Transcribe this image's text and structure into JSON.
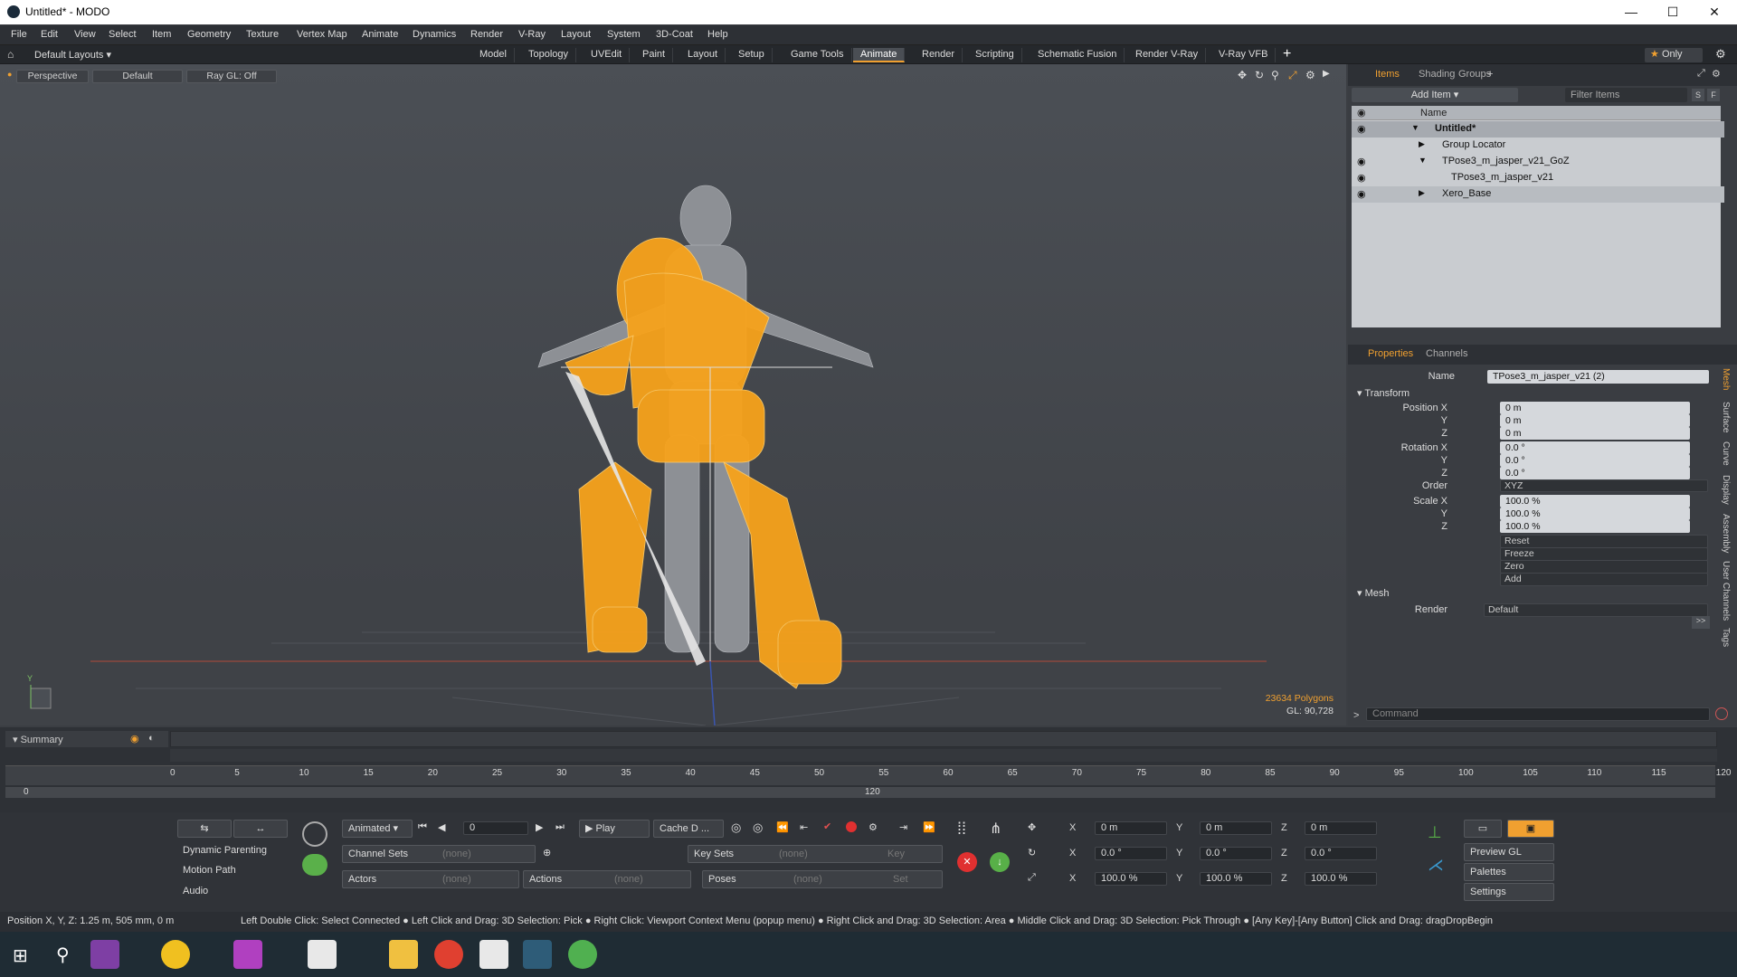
{
  "window": {
    "title": "Untitled* - MODO",
    "minimize": "—",
    "maximize": "☐",
    "close": "✕"
  },
  "menu": [
    "File",
    "Edit",
    "View",
    "Select",
    "Item",
    "Geometry",
    "Texture",
    "Vertex Map",
    "Animate",
    "Dynamics",
    "Render",
    "V-Ray",
    "Layout",
    "System",
    "3D-Coat",
    "Help"
  ],
  "layout_selector": "Default Layouts",
  "layout_tabs": [
    {
      "label": "Model",
      "active": false
    },
    {
      "label": "Topology",
      "active": false
    },
    {
      "label": "UVEdit",
      "active": false
    },
    {
      "label": "Paint",
      "active": false
    },
    {
      "label": "Layout",
      "active": false
    },
    {
      "label": "Setup",
      "active": false
    },
    {
      "label": "Game Tools",
      "active": false
    },
    {
      "label": "Animate",
      "active": true
    },
    {
      "label": "Render",
      "active": false
    },
    {
      "label": "Scripting",
      "active": false
    },
    {
      "label": "Schematic Fusion",
      "active": false
    },
    {
      "label": "Render V-Ray",
      "active": false
    },
    {
      "label": "V-Ray VFB",
      "active": false
    }
  ],
  "add_tab": "+",
  "only_label": "Only",
  "viewport": {
    "view": "Perspective",
    "shading": "Default",
    "raygl": "Ray GL: Off",
    "polygons": "23634 Polygons",
    "gl": "GL: 90,728",
    "axis_label": "Y"
  },
  "items_panel": {
    "tabs": [
      {
        "label": "Items",
        "active": true
      },
      {
        "label": "Shading",
        "active": false
      },
      {
        "label": "Groups",
        "active": false
      }
    ],
    "add_item": "Add Item",
    "filter_placeholder": "Filter Items",
    "s_button": "S",
    "f_button": "F",
    "column_name": "Name",
    "tree": [
      {
        "label": "Untitled*",
        "bold": true
      },
      {
        "label": "Group Locator",
        "bold": false
      },
      {
        "label": "TPose3_m_jasper_v21_GoZ",
        "bold": false
      },
      {
        "label": "TPose3_m_jasper_v21",
        "bold": false
      },
      {
        "label": "Xero_Base",
        "bold": false
      }
    ]
  },
  "properties_panel": {
    "tabs": [
      {
        "label": "Properties",
        "active": true
      },
      {
        "label": "Channels",
        "active": false
      }
    ],
    "name_label": "Name",
    "name_value": "TPose3_m_jasper_v21 (2)",
    "transform_header": "Transform",
    "position_x_label": "Position X",
    "rotation_x_label": "Rotation X",
    "scale_x_label": "Scale X",
    "y_label": "Y",
    "z_label": "Z",
    "position": [
      "0 m",
      "0 m",
      "0 m"
    ],
    "rotation": [
      "0.0 °",
      "0.0 °",
      "0.0 °"
    ],
    "order_label": "Order",
    "order": "XYZ",
    "scale": [
      "100.0 %",
      "100.0 %",
      "100.0 %"
    ],
    "actions": [
      "Reset",
      "Freeze",
      "Zero",
      "Add"
    ],
    "mesh_header": "Mesh",
    "render_label": "Render",
    "render_value": "Default",
    "more_button": ">>",
    "side_tabs": [
      "Mesh",
      "Surface",
      "Curve",
      "Display",
      "Assembly",
      "User Channels",
      "Tags"
    ]
  },
  "command": {
    "placeholder": "Command",
    "prompt": ">"
  },
  "timeline": {
    "summary": "Summary",
    "ticks": [
      "0",
      "5",
      "10",
      "15",
      "20",
      "25",
      "30",
      "35",
      "40",
      "45",
      "50",
      "55",
      "60",
      "65",
      "70",
      "75",
      "80",
      "85",
      "90",
      "95",
      "100",
      "105",
      "110",
      "115",
      "120"
    ],
    "range_start": "0",
    "range_end": "120"
  },
  "controls": {
    "dynamic_parenting": "Dynamic Parenting",
    "motion_path": "Motion Path",
    "audio": "Audio",
    "animated": "Animated",
    "frame": "0",
    "play": "Play",
    "cache": "Cache D ...",
    "channel_sets": "Channel Sets",
    "none": "(none)",
    "key_sets": "Key Sets",
    "key": "Key",
    "actors": "Actors",
    "actions": "Actions",
    "poses": "Poses",
    "set": "Set",
    "pos": [
      "0 m",
      "0 m",
      "0 m"
    ],
    "rot": [
      "0.0 °",
      "0.0 °",
      "0.0 °"
    ],
    "scl": [
      "100.0 %",
      "100.0 %",
      "100.0 %"
    ],
    "axis_x": "X",
    "axis_y": "Y",
    "axis_z": "Z",
    "preview_gl": "Preview GL",
    "palettes": "Palettes",
    "settings": "Settings"
  },
  "status": {
    "position": "Position X, Y, Z:   1.25 m, 505 mm, 0 m",
    "hints": "Left Double Click: Select Connected ● Left Click and Drag: 3D Selection: Pick ● Right Click: Viewport Context Menu (popup menu) ● Right Click and Drag: 3D Selection: Area ● Middle Click and Drag: 3D Selection: Pick Through ● [Any Key]-[Any Button] Click and Drag: dragDropBegin"
  },
  "colors": {
    "accent": "#f0a030",
    "mesh_orange": "#f7a21b",
    "bg_viewport": "#474b51"
  }
}
